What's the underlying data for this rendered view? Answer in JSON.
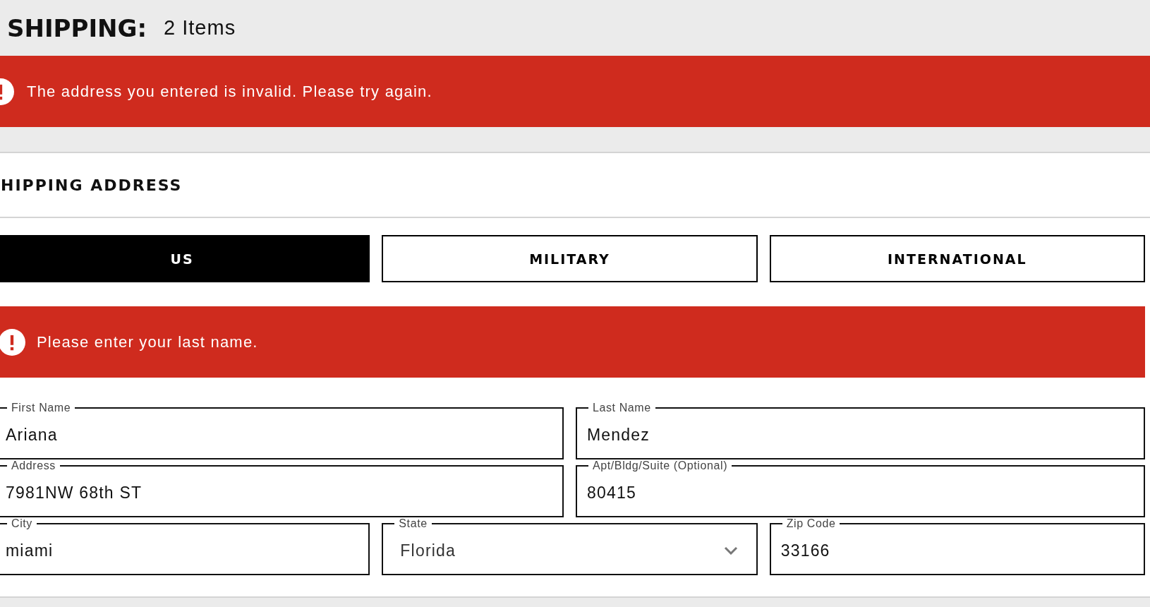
{
  "header": {
    "title": "SHIPPING:",
    "count": "2 Items"
  },
  "page_alert": {
    "message": "The address you entered is invalid. Please try again."
  },
  "section": {
    "title": "HIPPING ADDRESS"
  },
  "tabs": [
    {
      "label": "US",
      "selected": true
    },
    {
      "label": "MILITARY",
      "selected": false
    },
    {
      "label": "INTERNATIONAL",
      "selected": false
    }
  ],
  "form_alert": {
    "message": "Please enter your last name."
  },
  "rows": [
    [
      {
        "kind": "text",
        "label": "First Name",
        "value": "Ariana"
      },
      {
        "kind": "text",
        "label": "Last Name",
        "value": "Mendez"
      }
    ],
    [
      {
        "kind": "text",
        "label": "Address",
        "value": "7981NW 68th ST"
      },
      {
        "kind": "text",
        "label": "Apt/Bldg/Suite (Optional)",
        "value": "80415"
      }
    ],
    [
      {
        "kind": "text",
        "label": "City",
        "value": "miami"
      },
      {
        "kind": "select",
        "label": "State",
        "value": "Florida"
      },
      {
        "kind": "text",
        "label": "Zip Code",
        "value": "33166"
      }
    ]
  ]
}
